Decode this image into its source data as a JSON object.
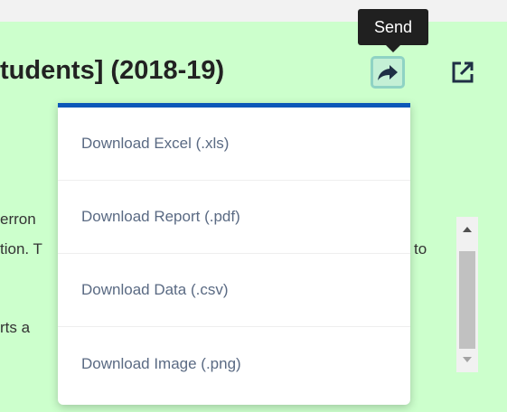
{
  "title": "tudents] (2018-19)",
  "tooltip": {
    "text": "Send"
  },
  "icons": {
    "send": "share-arrow-icon",
    "external": "open-external-icon"
  },
  "background_fragments": [
    "erron",
    "tion. T",
    "to",
    "rts a"
  ],
  "menu": {
    "items": [
      {
        "label": "Download Excel (.xls)"
      },
      {
        "label": "Download Report (.pdf)"
      },
      {
        "label": "Download Data (.csv)"
      },
      {
        "label": "Download Image (.png)"
      }
    ]
  },
  "colors": {
    "panel_background": "#ccffcc",
    "menu_accent": "#0b57b8",
    "menu_text": "#5a6a83",
    "tooltip_background": "#202020"
  }
}
